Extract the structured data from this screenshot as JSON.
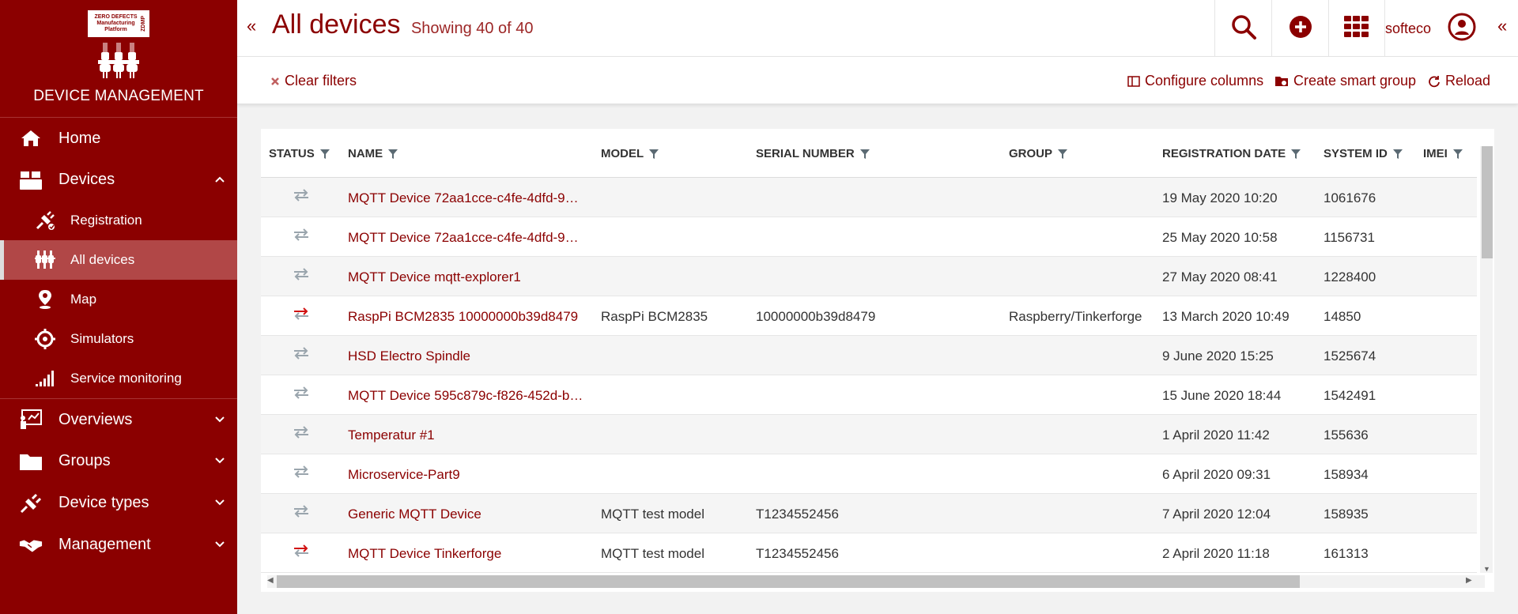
{
  "brand": {
    "logo_text": "ZERO DEFECTS Manufacturing Platform",
    "logo_side": "ZDMP",
    "title": "DEVICE MANAGEMENT"
  },
  "nav": {
    "home": "Home",
    "devices": "Devices",
    "registration": "Registration",
    "all_devices": "All devices",
    "map": "Map",
    "simulators": "Simulators",
    "service_monitoring": "Service monitoring",
    "overviews": "Overviews",
    "groups": "Groups",
    "device_types": "Device types",
    "management": "Management"
  },
  "header": {
    "title": "All devices",
    "subtitle": "Showing 40 of 40",
    "user": "softeco"
  },
  "toolbar": {
    "clear_filters": "Clear filters",
    "configure_columns": "Configure columns",
    "create_smart_group": "Create smart group",
    "reload": "Reload"
  },
  "table": {
    "columns": [
      "STATUS",
      "NAME",
      "MODEL",
      "SERIAL NUMBER",
      "GROUP",
      "REGISTRATION DATE",
      "SYSTEM ID",
      "IMEI"
    ],
    "rows": [
      {
        "status": "offline",
        "name": "MQTT Device 72aa1cce-c4fe-4dfd-9…",
        "model": "",
        "serial": "",
        "group": "",
        "date": "19 May 2020 10:20",
        "system_id": "1061676"
      },
      {
        "status": "offline",
        "name": "MQTT Device 72aa1cce-c4fe-4dfd-9…",
        "model": "",
        "serial": "",
        "group": "",
        "date": "25 May 2020 10:58",
        "system_id": "1156731"
      },
      {
        "status": "offline",
        "name": "MQTT Device mqtt-explorer1",
        "model": "",
        "serial": "",
        "group": "",
        "date": "27 May 2020 08:41",
        "system_id": "1228400"
      },
      {
        "status": "alert",
        "name": "RaspPi BCM2835 10000000b39d8479",
        "model": "RaspPi BCM2835",
        "serial": "10000000b39d8479",
        "group": "Raspberry/Tinkerforge",
        "date": "13 March 2020 10:49",
        "system_id": "14850"
      },
      {
        "status": "offline",
        "name": "HSD Electro Spindle",
        "model": "",
        "serial": "",
        "group": "",
        "date": "9 June 2020 15:25",
        "system_id": "1525674"
      },
      {
        "status": "offline",
        "name": "MQTT Device 595c879c-f826-452d-b…",
        "model": "",
        "serial": "",
        "group": "",
        "date": "15 June 2020 18:44",
        "system_id": "1542491"
      },
      {
        "status": "offline",
        "name": "Temperatur #1",
        "model": "",
        "serial": "",
        "group": "",
        "date": "1 April 2020 11:42",
        "system_id": "155636"
      },
      {
        "status": "offline",
        "name": "Microservice-Part9",
        "model": "",
        "serial": "",
        "group": "",
        "date": "6 April 2020 09:31",
        "system_id": "158934"
      },
      {
        "status": "offline",
        "name": "Generic MQTT Device",
        "model": "MQTT test model",
        "serial": "T1234552456",
        "group": "",
        "date": "7 April 2020 12:04",
        "system_id": "158935"
      },
      {
        "status": "alert",
        "name": "MQTT Device Tinkerforge",
        "model": "MQTT test model",
        "serial": "T1234552456",
        "group": "",
        "date": "2 April 2020 11:18",
        "system_id": "161313"
      }
    ]
  },
  "colors": {
    "brand": "#8b0000",
    "status_offline": "#9aa5ad",
    "status_alert": "#d11111"
  }
}
